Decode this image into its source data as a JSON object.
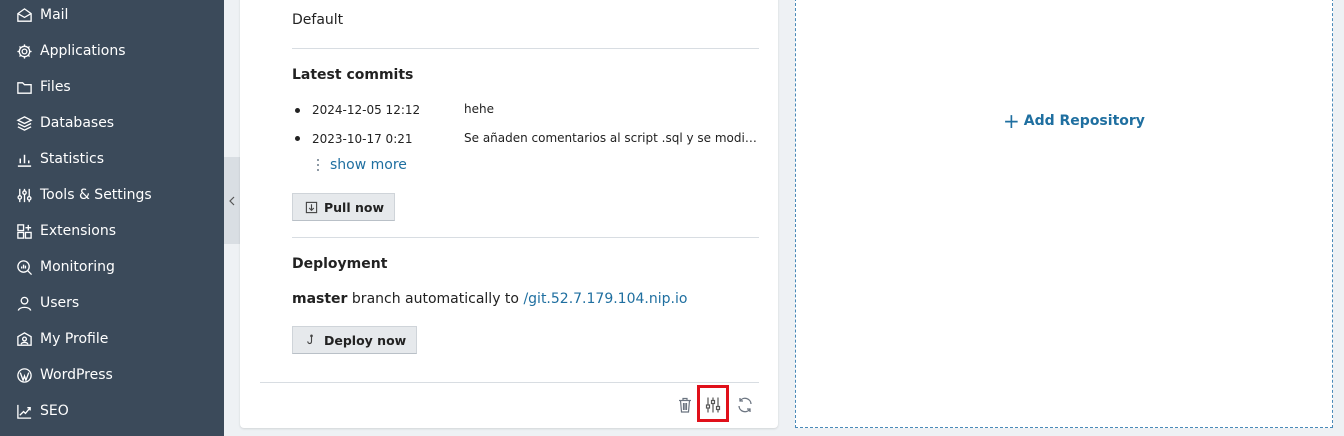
{
  "sidebar": {
    "items": [
      {
        "label": "Mail",
        "icon": "mail-icon"
      },
      {
        "label": "Applications",
        "icon": "gear-icon"
      },
      {
        "label": "Files",
        "icon": "folder-icon"
      },
      {
        "label": "Databases",
        "icon": "layers-icon"
      },
      {
        "label": "Statistics",
        "icon": "bar-chart-icon"
      },
      {
        "label": "Tools & Settings",
        "icon": "sliders-icon"
      },
      {
        "label": "Extensions",
        "icon": "puzzle-icon"
      },
      {
        "label": "Monitoring",
        "icon": "magnifier-icon"
      },
      {
        "label": "Users",
        "icon": "user-icon"
      },
      {
        "label": "My Profile",
        "icon": "profile-icon"
      },
      {
        "label": "WordPress",
        "icon": "wordpress-icon"
      },
      {
        "label": "SEO",
        "icon": "seo-chart-icon"
      }
    ]
  },
  "repo_card": {
    "branch_value": "Default",
    "latest_commits_title": "Latest commits",
    "commits": [
      {
        "date": "2024-12-05 12:12",
        "message": "hehe"
      },
      {
        "date": "2023-10-17 0:21",
        "message": "Se añaden comentarios al script .sql y se modifican..."
      }
    ],
    "show_more": "show more",
    "pull_now": "Pull now",
    "deployment_title": "Deployment",
    "deployment": {
      "branch": "master",
      "text": "branch automatically to",
      "path": "/git.52.7.179.104.nip.io"
    },
    "deploy_now": "Deploy now"
  },
  "add_repository": {
    "label": "Add Repository"
  },
  "colors": {
    "sidebar_bg": "#3b4a5a",
    "link": "#1f6fa0",
    "highlight": "#e0101a"
  }
}
